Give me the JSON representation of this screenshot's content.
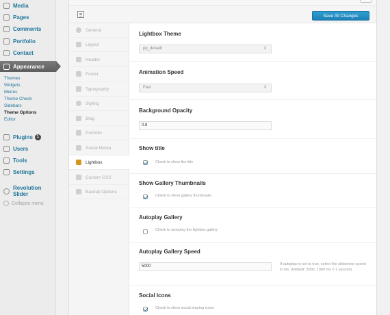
{
  "sidebar": {
    "items": [
      {
        "label": "Media",
        "icon": "media-icon"
      },
      {
        "label": "Pages",
        "icon": "pages-icon"
      },
      {
        "label": "Comments",
        "icon": "comments-icon"
      },
      {
        "label": "Portfolio",
        "icon": "portfolio-icon"
      },
      {
        "label": "Contact",
        "icon": "contact-icon"
      },
      {
        "label": "Appearance",
        "icon": "appearance-icon"
      }
    ],
    "appearance_sub": [
      "Themes",
      "Widgets",
      "Menus",
      "Theme Check",
      "Sidebars",
      "Theme Options",
      "Editor"
    ],
    "lower_items": [
      {
        "label": "Plugins",
        "icon": "plugins-icon",
        "badge": "1"
      },
      {
        "label": "Users",
        "icon": "users-icon"
      },
      {
        "label": "Tools",
        "icon": "tools-icon"
      },
      {
        "label": "Settings",
        "icon": "settings-icon"
      },
      {
        "label": "Revolution Slider",
        "icon": "revolution-slider-icon"
      }
    ],
    "collapse_label": "Collapse menu"
  },
  "toolbar": {
    "save_label": "Save All Changes"
  },
  "tabs": [
    "General",
    "Layout",
    "Header",
    "Footer",
    "Typography",
    "Styling",
    "Blog",
    "Portfolio",
    "Social Media",
    "Lightbox",
    "Custom CSS",
    "Backup Options"
  ],
  "active_tab": "Lightbox",
  "options": {
    "lightbox_theme": {
      "title": "Lightbox Theme",
      "value": "pp_default"
    },
    "animation_speed": {
      "title": "Animation Speed",
      "value": "Fast"
    },
    "background_opacity": {
      "title": "Background Opacity",
      "value": "0.8"
    },
    "show_title": {
      "title": "Show title",
      "label": "Check to show the title",
      "checked": true
    },
    "show_gallery_thumbnails": {
      "title": "Show Gallery Thumbnails",
      "label": "Check to show gallery thumbnails",
      "checked": true
    },
    "autoplay_gallery": {
      "title": "Autoplay Gallery",
      "label": "Check to autoplay the lightbox gallery",
      "checked": false
    },
    "autoplay_gallery_speed": {
      "title": "Autoplay Gallery Speed",
      "value": "5000",
      "description": "If autoplay is set to true, select the slideshow speed in ms. (Default: 5000, 1000 ms = 1 second)"
    },
    "social_icons": {
      "title": "Social Icons",
      "label": "Check to show social sharing icons",
      "checked": true
    }
  },
  "colors": {
    "link": "#21759b",
    "save_button": "#1e80b6",
    "active_menu": "#5e5e5e"
  }
}
